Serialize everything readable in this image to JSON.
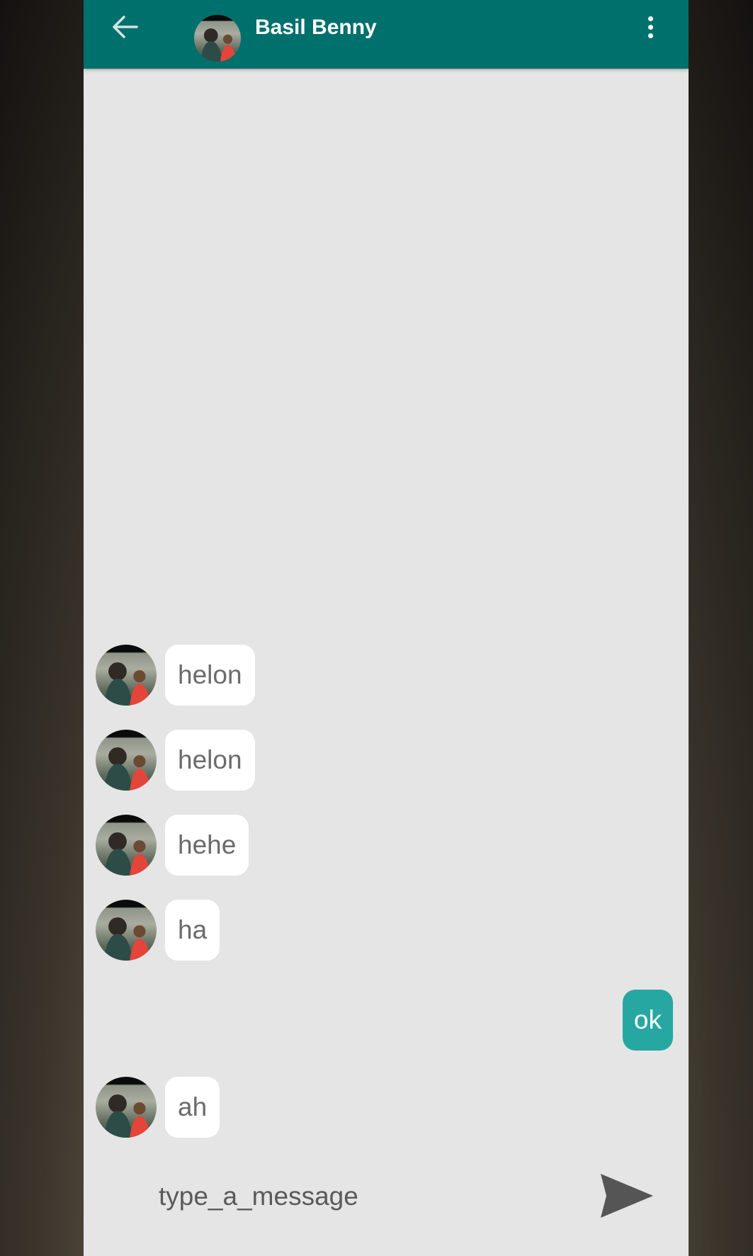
{
  "header": {
    "contact_name": "Basil Benny",
    "back_icon": "arrow-left-icon",
    "menu_icon": "more-vert-icon"
  },
  "messages": [
    {
      "direction": "in",
      "text": "helon"
    },
    {
      "direction": "in",
      "text": "helon"
    },
    {
      "direction": "in",
      "text": "hehe"
    },
    {
      "direction": "in",
      "text": "ha"
    },
    {
      "direction": "out",
      "text": "ok"
    },
    {
      "direction": "in",
      "text": "ah"
    }
  ],
  "composer": {
    "placeholder": "type_a_message",
    "value": "",
    "send_icon": "send-icon"
  },
  "colors": {
    "appbar": "#00706d",
    "outgoing_bubble": "#27a7a1",
    "incoming_bubble": "#ffffff",
    "chat_background": "#e5e5e5"
  }
}
